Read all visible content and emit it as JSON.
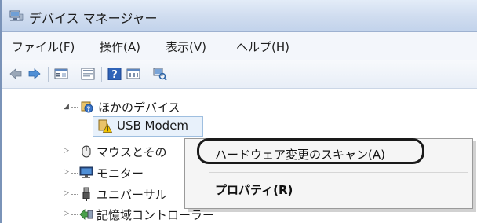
{
  "window": {
    "title": "デバイス マネージャー"
  },
  "menu": [
    {
      "label": "ファイル(F)"
    },
    {
      "label": "操作(A)"
    },
    {
      "label": "表示(V)"
    },
    {
      "label": "ヘルプ(H)"
    }
  ],
  "toolbar": {
    "buttons": [
      "back-icon",
      "forward-icon",
      "properties-icon",
      "console-icon",
      "help-icon",
      "view-icon",
      "scan-hardware-icon"
    ]
  },
  "tree": {
    "other_devices": "ほかのデバイス",
    "usb_modem": "USB Modem",
    "mouse": "マウスとその",
    "monitor": "モニター",
    "universal": "ユニバーサル",
    "storage": "記憶域コントローラー"
  },
  "context_menu": {
    "scan": "ハードウェア変更のスキャン(A)",
    "properties": "プロパティ(R)"
  },
  "colors": {
    "title_bar": "#cfdcef",
    "warning_yellow": "#f2c500",
    "highlight_ring": "#1a1a1a"
  }
}
